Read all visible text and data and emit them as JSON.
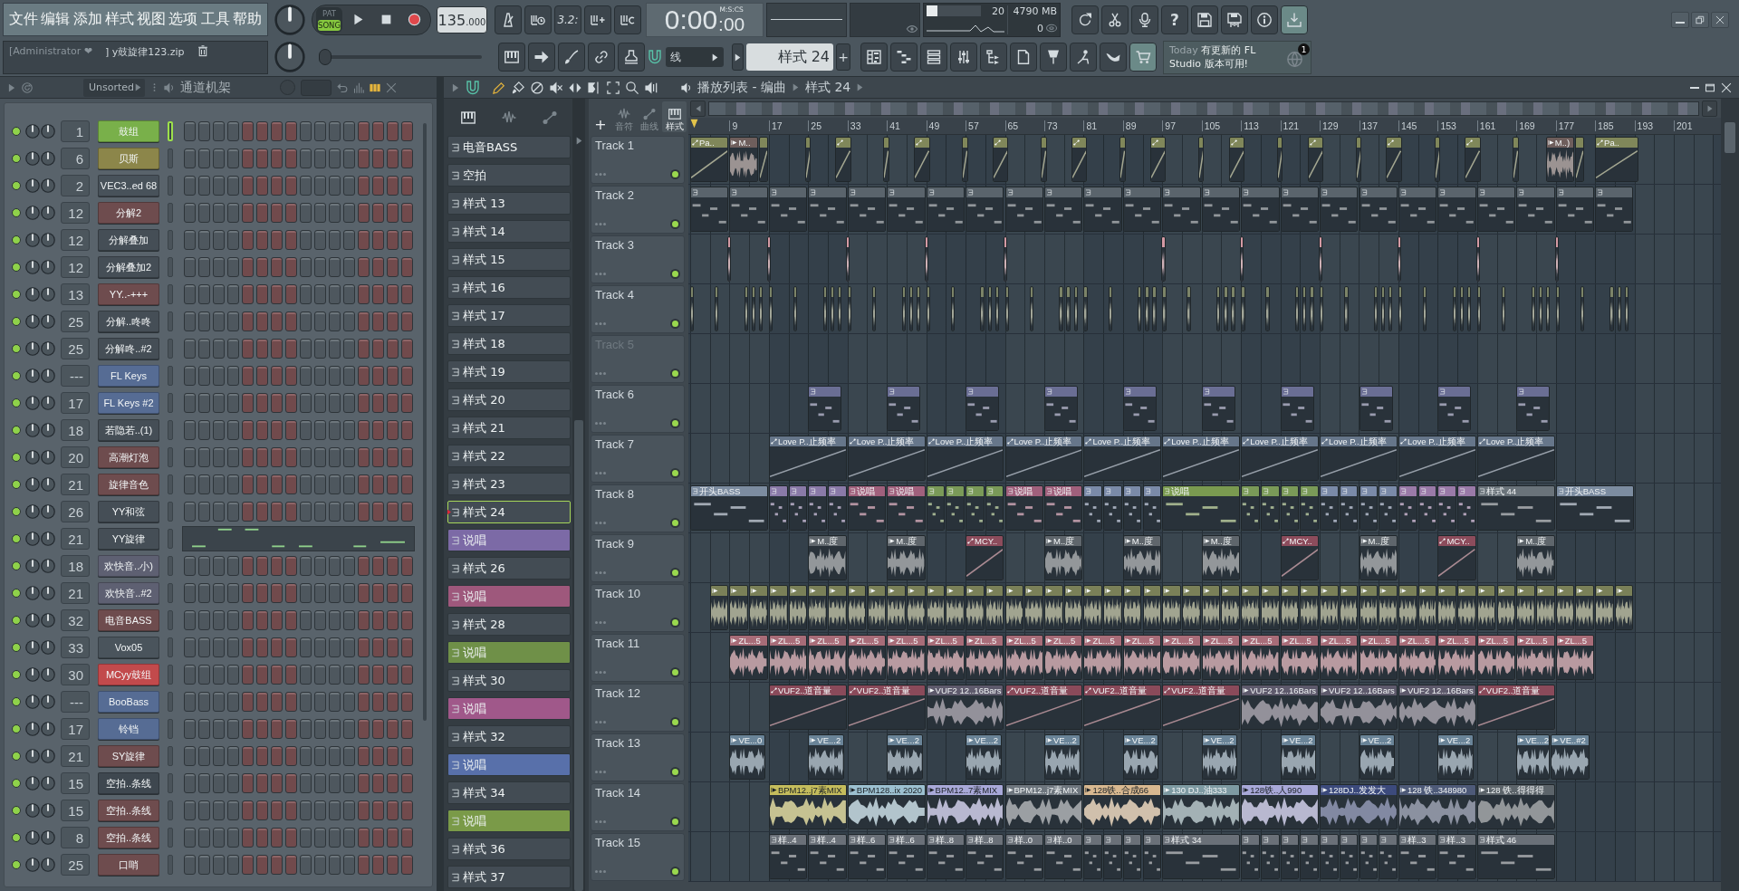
{
  "menu": [
    "文件",
    "编辑",
    "添加",
    "样式",
    "视图",
    "选项",
    "工具",
    "帮助"
  ],
  "project": {
    "user": "[Administrator ❤",
    "file": "] y鼓旋律123.zip"
  },
  "song_position": {
    "level": 0
  },
  "transport": {
    "modes": [
      {
        "label": "PAT",
        "selected": false
      },
      {
        "label": "SONG",
        "selected": true
      }
    ],
    "tempo": "135",
    "tempo_fraction": ".000"
  },
  "countdown": "3.2:",
  "time": {
    "main": "0:00",
    "sub": ":00",
    "unit": "M:S:CS"
  },
  "monitor": {
    "cpu": {
      "level": 0.2
    },
    "cpu_reading": "20",
    "memory": "4790 MB",
    "polyphony": "0"
  },
  "help": "?",
  "snap": "线",
  "pattern_selector": {
    "value": "样式 24",
    "add": "+"
  },
  "news": {
    "tag": "Today",
    "message": "有更新的 FL Studio 版本可用!",
    "badge": "1"
  },
  "channel_rack": {
    "filter": "Unsorted",
    "title": "通道机架",
    "channels": [
      {
        "number": "1",
        "name": "鼓组",
        "color": "#79b04a",
        "selected": true,
        "on": true,
        "kind": "steps"
      },
      {
        "number": "6",
        "name": "贝斯",
        "color": "#8c864a",
        "selected": false,
        "on": true,
        "kind": "steps"
      },
      {
        "number": "2",
        "name": "VEC3..ed 68",
        "color": "#48525a",
        "selected": false,
        "on": true,
        "kind": "steps"
      },
      {
        "number": "12",
        "name": "分解2",
        "color": "#6e4c4e",
        "selected": false,
        "on": true,
        "kind": "steps"
      },
      {
        "number": "12",
        "name": "分解叠加",
        "color": "#454e56",
        "selected": false,
        "on": true,
        "kind": "steps"
      },
      {
        "number": "12",
        "name": "分解叠加2",
        "color": "#454e56",
        "selected": false,
        "on": true,
        "kind": "steps"
      },
      {
        "number": "13",
        "name": "YY..-+++",
        "color": "#6e4c4e",
        "selected": false,
        "on": true,
        "kind": "steps"
      },
      {
        "number": "25",
        "name": "分解..咚咚",
        "color": "#454e56",
        "selected": false,
        "on": true,
        "kind": "steps"
      },
      {
        "number": "25",
        "name": "分解咚..#2",
        "color": "#454e56",
        "selected": false,
        "on": true,
        "kind": "steps"
      },
      {
        "number": "---",
        "name": "FL Keys",
        "color": "#566c94",
        "selected": false,
        "on": true,
        "kind": "steps"
      },
      {
        "number": "17",
        "name": "FL Keys #2",
        "color": "#566c94",
        "selected": false,
        "on": true,
        "kind": "steps"
      },
      {
        "number": "18",
        "name": "若隐若..(1)",
        "color": "#454e56",
        "selected": false,
        "on": true,
        "kind": "steps"
      },
      {
        "number": "20",
        "name": "高潮灯泡",
        "color": "#6e4c4e",
        "selected": false,
        "on": true,
        "kind": "steps"
      },
      {
        "number": "21",
        "name": "旋律音色",
        "color": "#6e4c4e",
        "selected": false,
        "on": true,
        "kind": "steps"
      },
      {
        "number": "26",
        "name": "YY和弦",
        "color": "#454e56",
        "selected": false,
        "on": true,
        "kind": "steps"
      },
      {
        "number": "21",
        "name": "YY旋律",
        "color": "#454e56",
        "selected": false,
        "on": true,
        "kind": "piano-roll"
      },
      {
        "number": "18",
        "name": "欢快音..小)",
        "color": "#5e6072",
        "selected": false,
        "on": true,
        "kind": "steps"
      },
      {
        "number": "21",
        "name": "欢快音..#2",
        "color": "#5e6072",
        "selected": false,
        "on": true,
        "kind": "steps"
      },
      {
        "number": "32",
        "name": "电音BASS",
        "color": "#6e4c4e",
        "selected": false,
        "on": true,
        "kind": "steps"
      },
      {
        "number": "33",
        "name": "Vox05",
        "color": "#4a545c",
        "selected": false,
        "on": true,
        "kind": "steps"
      },
      {
        "number": "30",
        "name": "MCyy鼓组",
        "color": "#c24a4c",
        "selected": false,
        "on": true,
        "kind": "steps"
      },
      {
        "number": "---",
        "name": "BooBass",
        "color": "#566c94",
        "selected": false,
        "on": true,
        "kind": "steps"
      },
      {
        "number": "17",
        "name": "铃铛",
        "color": "#566c94",
        "selected": false,
        "on": true,
        "kind": "steps"
      },
      {
        "number": "21",
        "name": "SY旋律",
        "color": "#6e4c4e",
        "selected": false,
        "on": true,
        "kind": "steps"
      },
      {
        "number": "15",
        "name": "空拍..条线",
        "color": "#3e474f",
        "selected": false,
        "on": true,
        "kind": "steps"
      },
      {
        "number": "15",
        "name": "空拍..条线",
        "color": "#6e4c4e",
        "selected": false,
        "on": true,
        "kind": "steps"
      },
      {
        "number": "8",
        "name": "空拍..条线",
        "color": "#6e4c4e",
        "selected": false,
        "on": true,
        "kind": "steps"
      },
      {
        "number": "25",
        "name": "口哨",
        "color": "#6e4c4e",
        "selected": false,
        "on": true,
        "kind": "steps"
      }
    ]
  },
  "pattern_picker": {
    "patterns": [
      {
        "name": "电音BASS",
        "color": "#434c54",
        "selected": false
      },
      {
        "name": "空拍",
        "color": "#434c54",
        "selected": false
      },
      {
        "name": "样式 13",
        "color": "#434c54",
        "selected": false
      },
      {
        "name": "样式 14",
        "color": "#434c54",
        "selected": false
      },
      {
        "name": "样式 15",
        "color": "#434c54",
        "selected": false
      },
      {
        "name": "样式 16",
        "color": "#434c54",
        "selected": false
      },
      {
        "name": "样式 17",
        "color": "#434c54",
        "selected": false
      },
      {
        "name": "样式 18",
        "color": "#434c54",
        "selected": false
      },
      {
        "name": "样式 19",
        "color": "#434c54",
        "selected": false
      },
      {
        "name": "样式 20",
        "color": "#434c54",
        "selected": false
      },
      {
        "name": "样式 21",
        "color": "#434c54",
        "selected": false
      },
      {
        "name": "样式 22",
        "color": "#434c54",
        "selected": false
      },
      {
        "name": "样式 23",
        "color": "#434c54",
        "selected": false
      },
      {
        "name": "样式 24",
        "color": "#434c54",
        "selected": true
      },
      {
        "name": "说唱",
        "color": "#7c6aa6",
        "selected": false
      },
      {
        "name": "样式 26",
        "color": "#434c54",
        "selected": false
      },
      {
        "name": "说唱",
        "color": "#9e587c",
        "selected": false
      },
      {
        "name": "样式 28",
        "color": "#434c54",
        "selected": false
      },
      {
        "name": "说唱",
        "color": "#6f9048",
        "selected": false
      },
      {
        "name": "样式 30",
        "color": "#434c54",
        "selected": false
      },
      {
        "name": "说唱",
        "color": "#a0588a",
        "selected": false
      },
      {
        "name": "样式 32",
        "color": "#434c54",
        "selected": false
      },
      {
        "name": "说唱",
        "color": "#5870aa",
        "selected": false
      },
      {
        "name": "样式 34",
        "color": "#434c54",
        "selected": false
      },
      {
        "name": "说唱",
        "color": "#7a9a48",
        "selected": false
      },
      {
        "name": "样式 36",
        "color": "#434c54",
        "selected": false
      },
      {
        "name": "样式 37",
        "color": "#434c54",
        "selected": false
      }
    ]
  },
  "playlist": {
    "title": "播放列表 - 编曲",
    "pattern": "样式 24",
    "add_track": "+",
    "lane_tabs": [
      {
        "label": "音符",
        "selected": false
      },
      {
        "label": "曲线",
        "selected": false
      },
      {
        "label": "样式",
        "selected": true
      }
    ],
    "ruler": [
      "9",
      "17",
      "25",
      "33",
      "41",
      "49",
      "57",
      "65",
      "73",
      "81",
      "89",
      "97",
      "105",
      "113",
      "121",
      "129",
      "137",
      "145",
      "153",
      "161",
      "169",
      "177",
      "185",
      "193",
      "201"
    ],
    "tracks": [
      {
        "name": "Track 1",
        "active": true,
        "clips": [
          {
            "kind": "automation",
            "label": "Pa..",
            "color": "#80875a"
          },
          {
            "kind": "audio",
            "label": "M..",
            "color": "#6e5e5c"
          },
          {
            "kind": "automation",
            "color": "#80875a"
          },
          {
            "kind": "automation",
            "color": "#80875a"
          },
          {
            "kind": "automation",
            "color": "#80875a"
          },
          {
            "kind": "automation",
            "color": "#80875a"
          },
          {
            "kind": "automation",
            "color": "#80875a"
          },
          {
            "kind": "automation",
            "color": "#80875a"
          },
          {
            "kind": "automation",
            "color": "#80875a"
          },
          {
            "kind": "automation",
            "color": "#80875a"
          },
          {
            "kind": "automation",
            "color": "#80875a"
          },
          {
            "kind": "automation",
            "color": "#80875a"
          },
          {
            "kind": "automation",
            "color": "#80875a"
          },
          {
            "kind": "automation",
            "color": "#80875a"
          },
          {
            "kind": "automation",
            "color": "#80875a"
          },
          {
            "kind": "automation",
            "color": "#80875a"
          },
          {
            "kind": "automation",
            "color": "#80875a"
          },
          {
            "kind": "automation",
            "color": "#80875a"
          },
          {
            "kind": "automation",
            "color": "#80875a"
          },
          {
            "kind": "automation",
            "color": "#80875a"
          },
          {
            "kind": "automation",
            "color": "#80875a"
          },
          {
            "kind": "automation",
            "color": "#80875a"
          },
          {
            "kind": "audio",
            "label": "M..)",
            "color": "#6e5e5c"
          },
          {
            "kind": "automation",
            "color": "#80875a"
          },
          {
            "kind": "automation",
            "label": "Pa..",
            "color": "#80875a"
          }
        ]
      },
      {
        "name": "Track 2",
        "active": true,
        "clips": [
          {
            "kind": "pattern",
            "color": "#5a646c"
          },
          {
            "kind": "pattern",
            "color": "#5a646c"
          },
          {
            "kind": "pattern",
            "color": "#5a646c"
          },
          {
            "kind": "pattern",
            "color": "#5a646c"
          },
          {
            "kind": "pattern",
            "color": "#5a646c"
          },
          {
            "kind": "pattern",
            "color": "#5a646c"
          },
          {
            "kind": "pattern",
            "color": "#5a646c"
          },
          {
            "kind": "pattern",
            "color": "#5a646c"
          },
          {
            "kind": "pattern",
            "color": "#5a646c"
          },
          {
            "kind": "pattern",
            "color": "#5a646c"
          },
          {
            "kind": "pattern",
            "color": "#5a646c"
          },
          {
            "kind": "pattern",
            "color": "#5a646c"
          },
          {
            "kind": "pattern",
            "color": "#5a646c"
          },
          {
            "kind": "pattern",
            "color": "#5a646c"
          },
          {
            "kind": "pattern",
            "color": "#5a646c"
          },
          {
            "kind": "pattern",
            "color": "#5a646c"
          },
          {
            "kind": "pattern",
            "color": "#5a646c"
          },
          {
            "kind": "pattern",
            "color": "#5a646c"
          },
          {
            "kind": "pattern",
            "color": "#5a646c"
          },
          {
            "kind": "pattern",
            "color": "#5a646c"
          },
          {
            "kind": "pattern",
            "color": "#5a646c"
          },
          {
            "kind": "pattern",
            "color": "#5a646c"
          },
          {
            "kind": "pattern",
            "color": "#5a646c"
          },
          {
            "kind": "pattern",
            "color": "#5a646c"
          }
        ]
      },
      {
        "name": "Track 3",
        "active": true,
        "clips": [
          {
            "kind": "audio",
            "color": "#d49aa4"
          },
          {
            "kind": "audio",
            "color": "#d49aa4"
          },
          {
            "kind": "audio",
            "color": "#d49aa4"
          },
          {
            "kind": "audio",
            "color": "#d49aa4"
          },
          {
            "kind": "audio",
            "color": "#d49aa4"
          },
          {
            "kind": "audio",
            "color": "#d49aa4"
          },
          {
            "kind": "audio",
            "color": "#d49aa4"
          },
          {
            "kind": "audio",
            "color": "#d49aa4"
          },
          {
            "kind": "audio",
            "color": "#d49aa4"
          },
          {
            "kind": "audio",
            "color": "#d49aa4"
          },
          {
            "kind": "audio",
            "color": "#d49aa4"
          }
        ]
      },
      {
        "name": "Track 4",
        "active": true,
        "clips": [
          {
            "kind": "audio",
            "color": "#7c8468"
          },
          {
            "kind": "audio",
            "color": "#7c8468"
          },
          {
            "kind": "audio",
            "color": "#7c8468"
          },
          {
            "kind": "audio",
            "color": "#7c8468"
          },
          {
            "kind": "audio",
            "color": "#7c8468"
          },
          {
            "kind": "audio",
            "color": "#7c8468"
          },
          {
            "kind": "audio",
            "color": "#7c8468"
          },
          {
            "kind": "audio",
            "color": "#7c8468"
          },
          {
            "kind": "audio",
            "color": "#7c8468"
          },
          {
            "kind": "audio",
            "color": "#7c8468"
          },
          {
            "kind": "audio",
            "color": "#7c8468"
          },
          {
            "kind": "audio",
            "color": "#7c8468"
          },
          {
            "kind": "audio",
            "color": "#7c8468"
          },
          {
            "kind": "audio",
            "color": "#7c8468"
          },
          {
            "kind": "audio",
            "color": "#7c8468"
          },
          {
            "kind": "audio",
            "color": "#7c8468"
          },
          {
            "kind": "audio",
            "color": "#7c8468"
          },
          {
            "kind": "audio",
            "color": "#7c8468"
          },
          {
            "kind": "audio",
            "color": "#7c8468"
          },
          {
            "kind": "audio",
            "color": "#7c8468"
          },
          {
            "kind": "audio",
            "color": "#7c8468"
          },
          {
            "kind": "audio",
            "color": "#7c8468"
          },
          {
            "kind": "audio",
            "color": "#7c8468"
          },
          {
            "kind": "audio",
            "color": "#7c8468"
          },
          {
            "kind": "audio",
            "color": "#7c8468"
          },
          {
            "kind": "audio",
            "color": "#7c8468"
          },
          {
            "kind": "audio",
            "color": "#7c8468"
          },
          {
            "kind": "audio",
            "color": "#7c8468"
          },
          {
            "kind": "audio",
            "color": "#7c8468"
          },
          {
            "kind": "audio",
            "color": "#7c8468"
          },
          {
            "kind": "audio",
            "color": "#7c8468"
          },
          {
            "kind": "audio",
            "color": "#7c8468"
          },
          {
            "kind": "audio",
            "color": "#7c8468"
          },
          {
            "kind": "audio",
            "color": "#7c8468"
          },
          {
            "kind": "audio",
            "color": "#7c8468"
          },
          {
            "kind": "audio",
            "color": "#7c8468"
          },
          {
            "kind": "audio",
            "color": "#7c8468"
          },
          {
            "kind": "audio",
            "color": "#7c8468"
          },
          {
            "kind": "audio",
            "color": "#7c8468"
          },
          {
            "kind": "audio",
            "color": "#7c8468"
          },
          {
            "kind": "audio",
            "color": "#7c8468"
          },
          {
            "kind": "audio",
            "color": "#7c8468"
          },
          {
            "kind": "audio",
            "color": "#7c8468"
          },
          {
            "kind": "audio",
            "color": "#7c8468"
          },
          {
            "kind": "audio",
            "color": "#7c8468"
          },
          {
            "kind": "audio",
            "color": "#7c8468"
          },
          {
            "kind": "audio",
            "color": "#7c8468"
          },
          {
            "kind": "audio",
            "color": "#7c8468"
          },
          {
            "kind": "audio",
            "color": "#7c8468"
          },
          {
            "kind": "audio",
            "color": "#7c8468"
          },
          {
            "kind": "audio",
            "color": "#7c8468"
          },
          {
            "kind": "audio",
            "color": "#7c8468"
          },
          {
            "kind": "audio",
            "color": "#7c8468"
          },
          {
            "kind": "audio",
            "color": "#7c8468"
          },
          {
            "kind": "audio",
            "color": "#7c8468"
          },
          {
            "kind": "audio",
            "color": "#7c8468"
          },
          {
            "kind": "audio",
            "color": "#7c8468"
          },
          {
            "kind": "audio",
            "color": "#7c8468"
          },
          {
            "kind": "audio",
            "color": "#7c8468"
          },
          {
            "kind": "audio",
            "color": "#7c8468"
          }
        ]
      },
      {
        "name": "Track 5",
        "active": false
      },
      {
        "name": "Track 6",
        "active": true,
        "clips": [
          {
            "kind": "pattern",
            "color": "#6a6e94"
          },
          {
            "kind": "pattern",
            "color": "#6a6e94"
          },
          {
            "kind": "pattern",
            "color": "#6a6e94"
          },
          {
            "kind": "pattern",
            "color": "#6a6e94"
          },
          {
            "kind": "pattern",
            "color": "#6a6e94"
          },
          {
            "kind": "pattern",
            "color": "#6a6e94"
          },
          {
            "kind": "pattern",
            "color": "#6a6e94"
          },
          {
            "kind": "pattern",
            "color": "#6a6e94"
          },
          {
            "kind": "pattern",
            "color": "#6a6e94"
          },
          {
            "kind": "pattern",
            "color": "#6a6e94"
          }
        ]
      },
      {
        "name": "Track 7",
        "active": true,
        "clips": [
          {
            "kind": "automation",
            "label": "Love P..止频率",
            "color": "#66768a"
          },
          {
            "kind": "automation",
            "label": "Love P..止频率",
            "color": "#66768a"
          },
          {
            "kind": "automation",
            "label": "Love P..止频率",
            "color": "#66768a"
          },
          {
            "kind": "automation",
            "label": "Love P..止频率",
            "color": "#66768a"
          },
          {
            "kind": "automation",
            "label": "Love P..止频率",
            "color": "#66768a"
          },
          {
            "kind": "automation",
            "label": "Love P..止频率",
            "color": "#66768a"
          },
          {
            "kind": "automation",
            "label": "Love P..止频率",
            "color": "#66768a"
          },
          {
            "kind": "automation",
            "label": "Love P..止频率",
            "color": "#66768a"
          },
          {
            "kind": "automation",
            "label": "Love P..止频率",
            "color": "#66768a"
          },
          {
            "kind": "automation",
            "label": "Love P..止频率",
            "color": "#66768a"
          }
        ]
      },
      {
        "name": "Track 8",
        "active": true,
        "clips": [
          {
            "kind": "pattern",
            "label": "开头BASS",
            "color": "#7c8ca0"
          },
          {
            "kind": "pattern",
            "color": "#8a7aa8"
          },
          {
            "kind": "pattern",
            "color": "#8a7aa8"
          },
          {
            "kind": "pattern",
            "color": "#8a7aa8"
          },
          {
            "kind": "pattern",
            "color": "#8a7aa8"
          },
          {
            "kind": "pattern",
            "label": "说唱",
            "color": "#a0607c"
          },
          {
            "kind": "pattern",
            "label": "说唱",
            "color": "#a0607c"
          },
          {
            "kind": "pattern",
            "color": "#7a9a58"
          },
          {
            "kind": "pattern",
            "color": "#7a9a58"
          },
          {
            "kind": "pattern",
            "color": "#7a9a58"
          },
          {
            "kind": "pattern",
            "color": "#7a9a58"
          },
          {
            "kind": "pattern",
            "label": "说唱",
            "color": "#a0607c"
          },
          {
            "kind": "pattern",
            "label": "说唱",
            "color": "#a0607c"
          },
          {
            "kind": "pattern",
            "color": "#7a8aa8"
          },
          {
            "kind": "pattern",
            "color": "#7a8aa8"
          },
          {
            "kind": "pattern",
            "color": "#7a8aa8"
          },
          {
            "kind": "pattern",
            "color": "#7a8aa8"
          },
          {
            "kind": "pattern",
            "label": "说唱",
            "color": "#7a9a50"
          },
          {
            "kind": "pattern",
            "color": "#7a9a58"
          },
          {
            "kind": "pattern",
            "color": "#7a9a58"
          },
          {
            "kind": "pattern",
            "color": "#7a9a58"
          },
          {
            "kind": "pattern",
            "color": "#7a9a58"
          },
          {
            "kind": "pattern",
            "color": "#7a8aa8"
          },
          {
            "kind": "pattern",
            "color": "#7a8aa8"
          },
          {
            "kind": "pattern",
            "color": "#7a8aa8"
          },
          {
            "kind": "pattern",
            "color": "#7a8aa8"
          },
          {
            "kind": "pattern",
            "color": "#9a7aa8"
          },
          {
            "kind": "pattern",
            "color": "#9a7aa8"
          },
          {
            "kind": "pattern",
            "color": "#9a7aa8"
          },
          {
            "kind": "pattern",
            "color": "#9a7aa8"
          },
          {
            "kind": "pattern",
            "label": "样式 44",
            "color": "#6a737a"
          },
          {
            "kind": "pattern",
            "label": "开头BASS",
            "color": "#7c8ca0"
          }
        ]
      },
      {
        "name": "Track 9",
        "active": true,
        "clips": [
          {
            "kind": "audio",
            "label": "M..度",
            "color": "#5f666c"
          },
          {
            "kind": "audio",
            "label": "M..度",
            "color": "#5f666c"
          },
          {
            "kind": "automation",
            "label": "MCY..",
            "color": "#8c4c5c"
          },
          {
            "kind": "audio",
            "label": "M..度",
            "color": "#5f666c"
          },
          {
            "kind": "audio",
            "label": "M..度",
            "color": "#5f666c"
          },
          {
            "kind": "audio",
            "label": "M..度",
            "color": "#5f666c"
          },
          {
            "kind": "automation",
            "label": "MCY..",
            "color": "#8c4c5c"
          },
          {
            "kind": "audio",
            "label": "M..度",
            "color": "#5f666c"
          },
          {
            "kind": "automation",
            "label": "MCY..",
            "color": "#8c4c5c"
          },
          {
            "kind": "audio",
            "label": "M..度",
            "color": "#5f666c"
          }
        ]
      },
      {
        "name": "Track 10",
        "active": true,
        "clips": [
          {
            "kind": "audio",
            "color": "#7a8058"
          },
          {
            "kind": "audio",
            "color": "#7a8058"
          },
          {
            "kind": "audio",
            "color": "#7a8058"
          },
          {
            "kind": "audio",
            "color": "#7a8058"
          },
          {
            "kind": "audio",
            "color": "#7a8058"
          },
          {
            "kind": "audio",
            "color": "#7a8058"
          },
          {
            "kind": "audio",
            "color": "#7a8058"
          },
          {
            "kind": "audio",
            "color": "#7a8058"
          },
          {
            "kind": "audio",
            "color": "#7a8058"
          },
          {
            "kind": "audio",
            "color": "#7a8058"
          },
          {
            "kind": "audio",
            "color": "#7a8058"
          },
          {
            "kind": "audio",
            "color": "#7a8058"
          },
          {
            "kind": "audio",
            "color": "#7a8058"
          },
          {
            "kind": "audio",
            "color": "#7a8058"
          },
          {
            "kind": "audio",
            "color": "#7a8058"
          },
          {
            "kind": "audio",
            "color": "#7a8058"
          },
          {
            "kind": "audio",
            "color": "#7a8058"
          },
          {
            "kind": "audio",
            "color": "#7a8058"
          },
          {
            "kind": "audio",
            "color": "#7a8058"
          },
          {
            "kind": "audio",
            "color": "#7a8058"
          },
          {
            "kind": "audio",
            "color": "#7a8058"
          },
          {
            "kind": "audio",
            "color": "#7a8058"
          },
          {
            "kind": "audio",
            "color": "#7a8058"
          },
          {
            "kind": "audio",
            "color": "#7a8058"
          },
          {
            "kind": "audio",
            "color": "#7a8058"
          },
          {
            "kind": "audio",
            "color": "#7a8058"
          },
          {
            "kind": "audio",
            "color": "#7a8058"
          },
          {
            "kind": "audio",
            "color": "#7a8058"
          },
          {
            "kind": "audio",
            "color": "#7a8058"
          },
          {
            "kind": "audio",
            "color": "#7a8058"
          },
          {
            "kind": "audio",
            "color": "#7a8058"
          },
          {
            "kind": "audio",
            "color": "#7a8058"
          },
          {
            "kind": "audio",
            "color": "#7a8058"
          },
          {
            "kind": "audio",
            "color": "#7a8058"
          },
          {
            "kind": "audio",
            "color": "#7a8058"
          },
          {
            "kind": "audio",
            "color": "#7a8058"
          },
          {
            "kind": "audio",
            "color": "#7a8058"
          },
          {
            "kind": "audio",
            "color": "#7a8058"
          },
          {
            "kind": "audio",
            "color": "#7a8058"
          },
          {
            "kind": "audio",
            "color": "#7a8058"
          },
          {
            "kind": "audio",
            "color": "#7a8058"
          },
          {
            "kind": "audio",
            "color": "#7a8058"
          },
          {
            "kind": "audio",
            "color": "#7a8058"
          },
          {
            "kind": "audio",
            "color": "#7a8058"
          },
          {
            "kind": "audio",
            "color": "#7a8058"
          },
          {
            "kind": "audio",
            "color": "#7a8058"
          },
          {
            "kind": "audio",
            "color": "#7a8058"
          }
        ]
      },
      {
        "name": "Track 11",
        "active": true,
        "clips": [
          {
            "kind": "audio",
            "label": "ZL...5",
            "color": "#a86c78"
          },
          {
            "kind": "audio",
            "label": "ZL...5",
            "color": "#a86c78"
          },
          {
            "kind": "audio",
            "label": "ZL...5",
            "color": "#a86c78"
          },
          {
            "kind": "audio",
            "label": "ZL...5",
            "color": "#a86c78"
          },
          {
            "kind": "audio",
            "label": "ZL...5",
            "color": "#a86c78"
          },
          {
            "kind": "audio",
            "label": "ZL...5",
            "color": "#a86c78"
          },
          {
            "kind": "audio",
            "label": "ZL...5",
            "color": "#a86c78"
          },
          {
            "kind": "audio",
            "label": "ZL...5",
            "color": "#a86c78"
          },
          {
            "kind": "audio",
            "label": "ZL...5",
            "color": "#a86c78"
          },
          {
            "kind": "audio",
            "label": "ZL...5",
            "color": "#a86c78"
          },
          {
            "kind": "audio",
            "label": "ZL...5",
            "color": "#a86c78"
          },
          {
            "kind": "audio",
            "label": "ZL...5",
            "color": "#a86c78"
          },
          {
            "kind": "audio",
            "label": "ZL...5",
            "color": "#a86c78"
          },
          {
            "kind": "audio",
            "label": "ZL...5",
            "color": "#a86c78"
          },
          {
            "kind": "audio",
            "label": "ZL...5",
            "color": "#a86c78"
          },
          {
            "kind": "audio",
            "label": "ZL...5",
            "color": "#a86c78"
          },
          {
            "kind": "audio",
            "label": "ZL...5",
            "color": "#a86c78"
          },
          {
            "kind": "audio",
            "label": "ZL...5",
            "color": "#a86c78"
          },
          {
            "kind": "audio",
            "label": "ZL...5",
            "color": "#a86c78"
          },
          {
            "kind": "audio",
            "label": "ZL...5",
            "color": "#a86c78"
          },
          {
            "kind": "audio",
            "label": "ZL...5",
            "color": "#a86c78"
          },
          {
            "kind": "audio",
            "label": "ZL...5",
            "color": "#a86c78"
          }
        ]
      },
      {
        "name": "Track 12",
        "active": true,
        "clips": [
          {
            "kind": "automation",
            "label": "VUF2..道音量",
            "color": "#8a4a5a"
          },
          {
            "kind": "automation",
            "label": "VUF2..道音量",
            "color": "#8a4a5a"
          },
          {
            "kind": "audio",
            "label": "VUF2 12..16Bars",
            "color": "#5e5a6c"
          },
          {
            "kind": "automation",
            "label": "VUF2..道音量",
            "color": "#8a4a5a"
          },
          {
            "kind": "automation",
            "label": "VUF2..道音量",
            "color": "#8a4a5a"
          },
          {
            "kind": "automation",
            "label": "VUF2..道音量",
            "color": "#8a4a5a"
          },
          {
            "kind": "audio",
            "label": "VUF2 12..16Bars",
            "color": "#5e5a6c"
          },
          {
            "kind": "audio",
            "label": "VUF2 12..16Bars",
            "color": "#5e5a6c"
          },
          {
            "kind": "audio",
            "label": "VUF2 12..16Bars",
            "color": "#5e5a6c"
          },
          {
            "kind": "automation",
            "label": "VUF2..道音量",
            "color": "#8a4a5a"
          }
        ]
      },
      {
        "name": "Track 13",
        "active": true,
        "clips": [
          {
            "kind": "audio",
            "label": "VE...0",
            "color": "#6a8498"
          },
          {
            "kind": "audio",
            "label": "VE...2",
            "color": "#6a8498"
          },
          {
            "kind": "audio",
            "label": "VE...2",
            "color": "#6a8498"
          },
          {
            "kind": "audio",
            "label": "VE...2",
            "color": "#6a8498"
          },
          {
            "kind": "audio",
            "label": "VE...2",
            "color": "#6a8498"
          },
          {
            "kind": "audio",
            "label": "VE...2",
            "color": "#6a8498"
          },
          {
            "kind": "audio",
            "label": "VE...2",
            "color": "#6a8498"
          },
          {
            "kind": "audio",
            "label": "VE...2",
            "color": "#6a8498"
          },
          {
            "kind": "audio",
            "label": "VE...2",
            "color": "#6a8498"
          },
          {
            "kind": "audio",
            "label": "VE...2",
            "color": "#6a8498"
          },
          {
            "kind": "audio",
            "label": "VE...2",
            "color": "#6a8498"
          },
          {
            "kind": "audio",
            "label": "VE..#2",
            "color": "#6a8498"
          }
        ]
      },
      {
        "name": "Track 14",
        "active": true,
        "clips": [
          {
            "kind": "audio",
            "label": "BPM12..j7素MIX",
            "color": "#c4bc5c"
          },
          {
            "kind": "audio",
            "label": "BPM128..ix 2020",
            "color": "#9cc0d0"
          },
          {
            "kind": "audio",
            "label": "BPM12..7素MIX",
            "color": "#a8a8d8"
          },
          {
            "kind": "audio",
            "label": "BPM12..j7素MIX",
            "color": "#6e767e"
          },
          {
            "kind": "audio",
            "label": "128铁..合成66",
            "color": "#d8b890"
          },
          {
            "kind": "audio",
            "label": "130 DJ..油333",
            "color": "#7e9aa2"
          },
          {
            "kind": "audio",
            "label": "128铁..人990",
            "color": "#a8a8d8"
          },
          {
            "kind": "audio",
            "label": "128DJ..发发大",
            "color": "#3c4a7c"
          },
          {
            "kind": "audio",
            "label": "128 铁..348980",
            "color": "#4e5a78"
          },
          {
            "kind": "audio",
            "label": "128 铁..得得得",
            "color": "#5c646a"
          }
        ]
      },
      {
        "name": "Track 15",
        "active": true,
        "clips": [
          {
            "kind": "pattern",
            "label": "样..4",
            "color": "#6a7078"
          },
          {
            "kind": "pattern",
            "label": "样..4",
            "color": "#6a7078"
          },
          {
            "kind": "pattern",
            "label": "样..6",
            "color": "#6a7078"
          },
          {
            "kind": "pattern",
            "label": "样..6",
            "color": "#6a7078"
          },
          {
            "kind": "pattern",
            "label": "样..8",
            "color": "#6a7078"
          },
          {
            "kind": "pattern",
            "label": "样..8",
            "color": "#6a7078"
          },
          {
            "kind": "pattern",
            "label": "样..0",
            "color": "#6a7078"
          },
          {
            "kind": "pattern",
            "label": "样..0",
            "color": "#6a7078"
          },
          {
            "kind": "pattern",
            "color": "#6a7078"
          },
          {
            "kind": "pattern",
            "color": "#6a7078"
          },
          {
            "kind": "pattern",
            "color": "#6a7078"
          },
          {
            "kind": "pattern",
            "color": "#6a7078"
          },
          {
            "kind": "pattern",
            "label": "样式 34",
            "color": "#6a7078"
          },
          {
            "kind": "pattern",
            "color": "#6a7078"
          },
          {
            "kind": "pattern",
            "color": "#6a7078"
          },
          {
            "kind": "pattern",
            "color": "#6a7078"
          },
          {
            "kind": "pattern",
            "color": "#6a7078"
          },
          {
            "kind": "pattern",
            "color": "#6a7078"
          },
          {
            "kind": "pattern",
            "color": "#6a7078"
          },
          {
            "kind": "pattern",
            "color": "#6a7078"
          },
          {
            "kind": "pattern",
            "color": "#6a7078"
          },
          {
            "kind": "pattern",
            "label": "样..3",
            "color": "#6a7078"
          },
          {
            "kind": "pattern",
            "label": "样..3",
            "color": "#6a7078"
          },
          {
            "kind": "pattern",
            "label": "样式 46",
            "color": "#6a7078"
          }
        ]
      }
    ]
  }
}
